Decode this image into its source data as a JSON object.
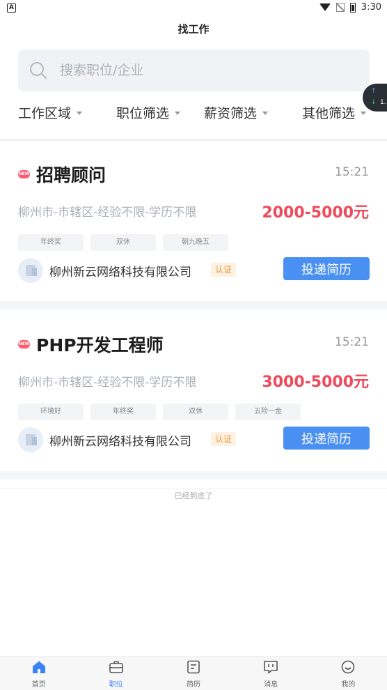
{
  "status_bar": {
    "time": "3:30"
  },
  "header": {
    "title": "找工作"
  },
  "search": {
    "placeholder": "搜索职位/企业"
  },
  "float_widget": {
    "up_value": "",
    "down_value": "1."
  },
  "filters": [
    {
      "label": "工作区域"
    },
    {
      "label": "职位筛选"
    },
    {
      "label": "薪资筛选"
    },
    {
      "label": "其他筛选"
    }
  ],
  "jobs": [
    {
      "badge": "NEW",
      "title": "招聘顾问",
      "time": "15:21",
      "meta": "柳州市-市辖区-经验不限-学历不限",
      "salary": "2000-5000元",
      "tags": [
        "年终奖",
        "双休",
        "朝九晚五"
      ],
      "company": "柳州新云网络科技有限公司",
      "cert": "认证",
      "apply_label": "投递简历"
    },
    {
      "badge": "NEW",
      "title": "PHP开发工程师",
      "time": "15:21",
      "meta": "柳州市-市辖区-经验不限-学历不限",
      "salary": "3000-5000元",
      "tags": [
        "环境好",
        "年终奖",
        "双休",
        "五险一金"
      ],
      "company": "柳州新云网络科技有限公司",
      "cert": "认证",
      "apply_label": "投递简历"
    }
  ],
  "list_end_text": "已经到底了",
  "bottom_nav": [
    {
      "label": "首页",
      "icon": "home-icon",
      "active": false
    },
    {
      "label": "职位",
      "icon": "briefcase-icon",
      "active": true
    },
    {
      "label": "简历",
      "icon": "resume-icon",
      "active": false
    },
    {
      "label": "消息",
      "icon": "message-icon",
      "active": false
    },
    {
      "label": "我的",
      "icon": "profile-icon",
      "active": false
    }
  ],
  "colors": {
    "accent": "#4a90f2",
    "salary": "#ef4a5a",
    "cert": "#ef9a3a",
    "nav_active": "#3b82f6"
  }
}
